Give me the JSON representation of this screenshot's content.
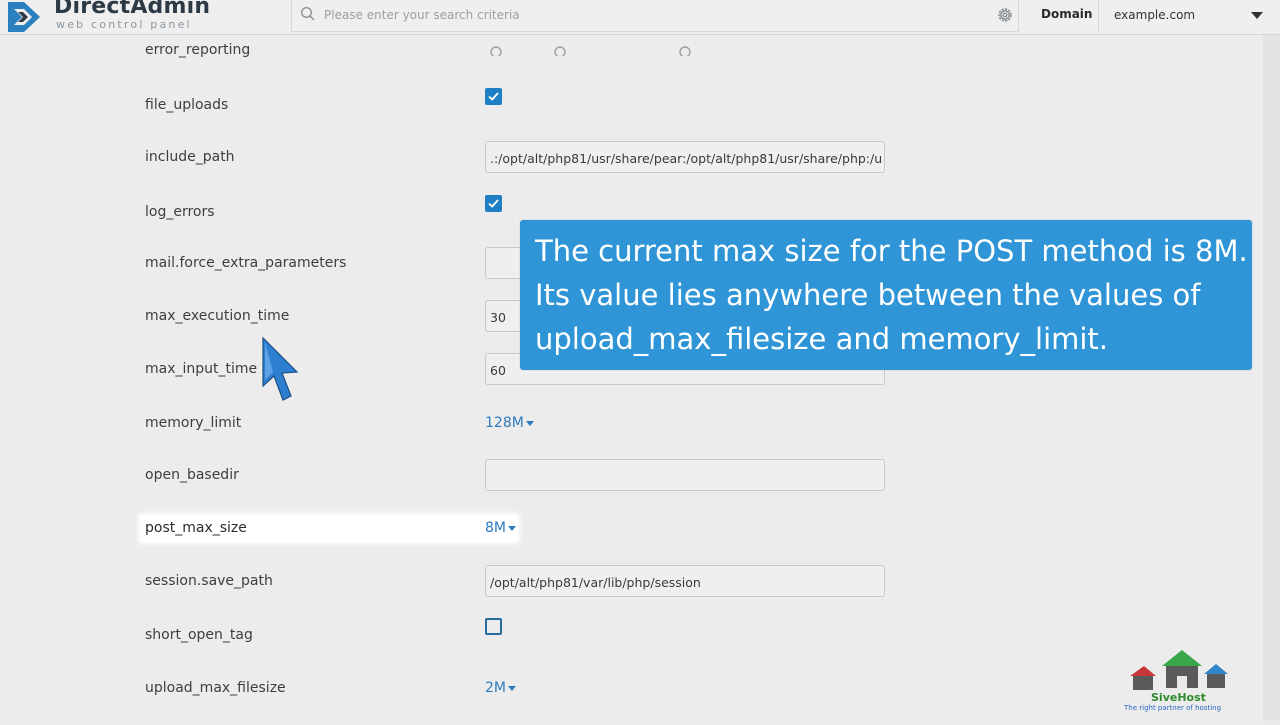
{
  "header": {
    "logo_title": "DirectAdmin",
    "logo_subtitle": "web control panel",
    "search_placeholder": "Please enter your search criteria",
    "domain_label": "Domain",
    "domain_value": "example.com"
  },
  "settings": [
    {
      "name": "error_reporting",
      "type": "radio"
    },
    {
      "name": "file_uploads",
      "type": "checkbox",
      "checked": true
    },
    {
      "name": "include_path",
      "type": "text",
      "value": ".:/opt/alt/php81/usr/share/pear:/opt/alt/php81/usr/share/php:/u"
    },
    {
      "name": "log_errors",
      "type": "checkbox",
      "checked": true
    },
    {
      "name": "mail.force_extra_parameters",
      "type": "text",
      "value": ""
    },
    {
      "name": "max_execution_time",
      "type": "text",
      "value": "30"
    },
    {
      "name": "max_input_time",
      "type": "text",
      "value": "60"
    },
    {
      "name": "memory_limit",
      "type": "dropdown",
      "value": "128M"
    },
    {
      "name": "open_basedir",
      "type": "text",
      "value": ""
    },
    {
      "name": "post_max_size",
      "type": "dropdown",
      "value": "8M",
      "highlighted": true
    },
    {
      "name": "session.save_path",
      "type": "text",
      "value": "/opt/alt/php81/var/lib/php/session"
    },
    {
      "name": "short_open_tag",
      "type": "checkbox",
      "checked": false
    },
    {
      "name": "upload_max_filesize",
      "type": "dropdown",
      "value": "2M"
    }
  ],
  "callout": {
    "lines": [
      "The current max size for the POST method is 8M.",
      "Its value lies anywhere between the values of",
      "upload_max_filesize and memory_limit."
    ]
  },
  "watermark": {
    "name": "SiveHost",
    "tagline": "The right partner of hosting"
  },
  "colors": {
    "accent": "#2f7bbf",
    "callout_bg": "#2f95d6",
    "checkbox_on": "#1f7fc4"
  },
  "icons": [
    "directadmin-logo-icon",
    "search-icon",
    "gear-icon",
    "chevron-down-icon",
    "check-icon",
    "mouse-cursor-icon"
  ]
}
